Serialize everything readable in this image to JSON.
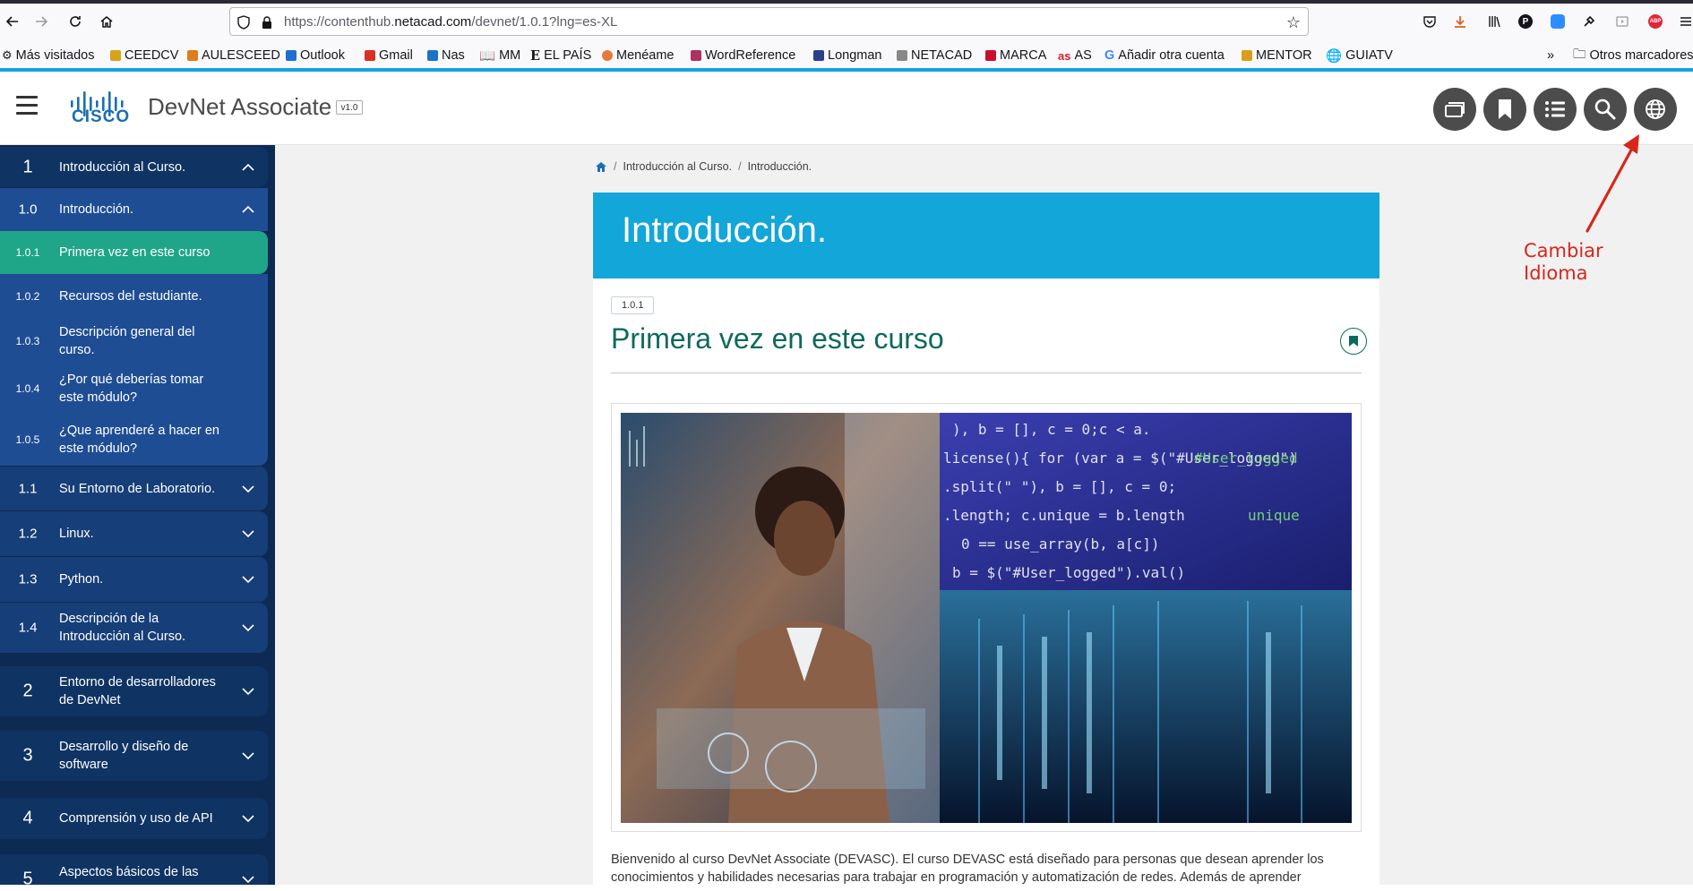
{
  "browser": {
    "url_prefix": "https://contenthub.",
    "url_domain": "netacad.com",
    "url_suffix": "/devnet/1.0.1?lng=es-XL",
    "bookmarks": [
      {
        "label": "Más visitados",
        "color": "#333333"
      },
      {
        "label": "CEEDCV",
        "color": "#d9a21b"
      },
      {
        "label": "AULESCEED",
        "color": "#e07b1e"
      },
      {
        "label": "Outlook",
        "color": "#1e6fd0"
      },
      {
        "label": "Gmail",
        "color": "#d93025"
      },
      {
        "label": "Nas",
        "color": "#1a73c7"
      },
      {
        "label": "MM",
        "color": "#c0392b"
      },
      {
        "label": "EL PAÍS",
        "color": "#111111"
      },
      {
        "label": "Menéame",
        "color": "#e5793b"
      },
      {
        "label": "WordReference",
        "color": "#b03060"
      },
      {
        "label": "Longman",
        "color": "#2c3e8c"
      },
      {
        "label": "NETACAD",
        "color": "#888888"
      },
      {
        "label": "MARCA",
        "color": "#c8102e"
      },
      {
        "label": "AS",
        "color": "#d81e2b"
      },
      {
        "label": "Añadir otra cuenta",
        "color": "#4285f4"
      },
      {
        "label": "MENTOR",
        "color": "#d99e1d"
      },
      {
        "label": "GUIATV",
        "color": "#333333"
      }
    ],
    "other_bookmarks": "Otros marcadores"
  },
  "header": {
    "brand": "CISCO",
    "course_title": "DevNet Associate",
    "version": "v1.0",
    "buttons": [
      "resources-icon",
      "bookmarks-icon",
      "toc-list-icon",
      "search-icon",
      "globe-icon"
    ]
  },
  "sidebar": {
    "items": [
      {
        "num": "1",
        "label": "Introducción al Curso.",
        "kind": "mod",
        "chev": "up"
      },
      {
        "num": "1.0",
        "label": "Introducción.",
        "kind": "sub",
        "chev": "up"
      },
      {
        "num": "1.0.1",
        "label": "Primera vez en este curso",
        "kind": "topic-active"
      },
      {
        "num": "1.0.2",
        "label": "Recursos del estudiante.",
        "kind": "topic"
      },
      {
        "num": "1.0.3",
        "label": "Descripción general del curso.",
        "kind": "topic"
      },
      {
        "num": "1.0.4",
        "label": "¿Por qué deberías tomar este módulo?",
        "kind": "topic"
      },
      {
        "num": "1.0.5",
        "label": "¿Que aprenderé a hacer en este módulo?",
        "kind": "topic"
      },
      {
        "num": "1.1",
        "label": "Su Entorno de Laboratorio.",
        "kind": "sub-closed",
        "chev": "down"
      },
      {
        "num": "1.2",
        "label": "Linux.",
        "kind": "sub-closed",
        "chev": "down"
      },
      {
        "num": "1.3",
        "label": "Python.",
        "kind": "sub-closed",
        "chev": "down"
      },
      {
        "num": "1.4",
        "label": "Descripción de la Introducción al Curso.",
        "kind": "sub-closed",
        "chev": "down"
      },
      {
        "num": "2",
        "label": "Entorno de desarrolladores de DevNet",
        "kind": "mod",
        "chev": "down"
      },
      {
        "num": "3",
        "label": "Desarrollo y diseño de software",
        "kind": "mod",
        "chev": "down"
      },
      {
        "num": "4",
        "label": "Comprensión y uso de API",
        "kind": "mod",
        "chev": "down"
      },
      {
        "num": "5",
        "label": "Aspectos básicos de las",
        "kind": "mod",
        "chev": "down"
      }
    ]
  },
  "main": {
    "breadcrumb": [
      "Introducción al Curso.",
      "Introducción."
    ],
    "banner_title": "Introducción.",
    "topic_number": "1.0.1",
    "topic_title": "Primera vez en este curso",
    "body": "Bienvenido al curso DevNet Associate (DEVASC). El curso DEVASC está diseñado para personas que desean aprender los conocimientos y habilidades necesarias para trabajar en programación y automatización de redes. Además de aprender"
  },
  "annotation": {
    "line1": "Cambiar",
    "line2": "Idioma",
    "color": "#d8261b"
  },
  "colors": {
    "sidebar_bg": "#0d2a52",
    "active_topic": "#1fa588",
    "banner": "#13a6d9",
    "title_green": "#0c6a5c",
    "header_button": "#4c4c4c"
  }
}
